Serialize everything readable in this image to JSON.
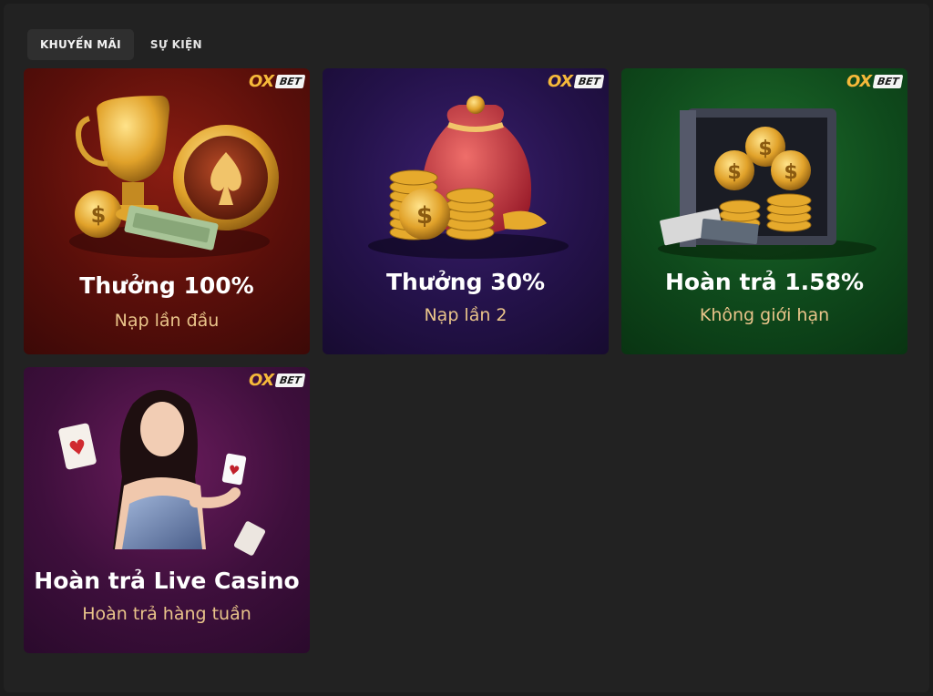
{
  "tabs": [
    {
      "label": "KHUYẾN MÃI",
      "active": true
    },
    {
      "label": "SỰ KIỆN",
      "active": false
    }
  ],
  "brand": {
    "ox": "OX",
    "bet": "BET"
  },
  "promos": [
    {
      "title": "Thưởng 100%",
      "subtitle": "Nạp lần đầu",
      "theme": "red",
      "art": "trophy-poker-chip-coins-cash"
    },
    {
      "title": "Thưởng 30%",
      "subtitle": "Nạp lần 2",
      "theme": "purple",
      "art": "money-bag-coin-stacks"
    },
    {
      "title": "Hoàn trả 1.58%",
      "subtitle": "Không giới hạn",
      "theme": "green",
      "art": "safe-coins-cash"
    },
    {
      "title": "Hoàn trả Live Casino",
      "subtitle": "Hoàn trả hàng tuần",
      "theme": "magenta",
      "art": "dealer-playing-cards"
    }
  ],
  "colors": {
    "gold": "#f5b93a",
    "subtitle": "#e9c48a",
    "background": "#222222"
  }
}
